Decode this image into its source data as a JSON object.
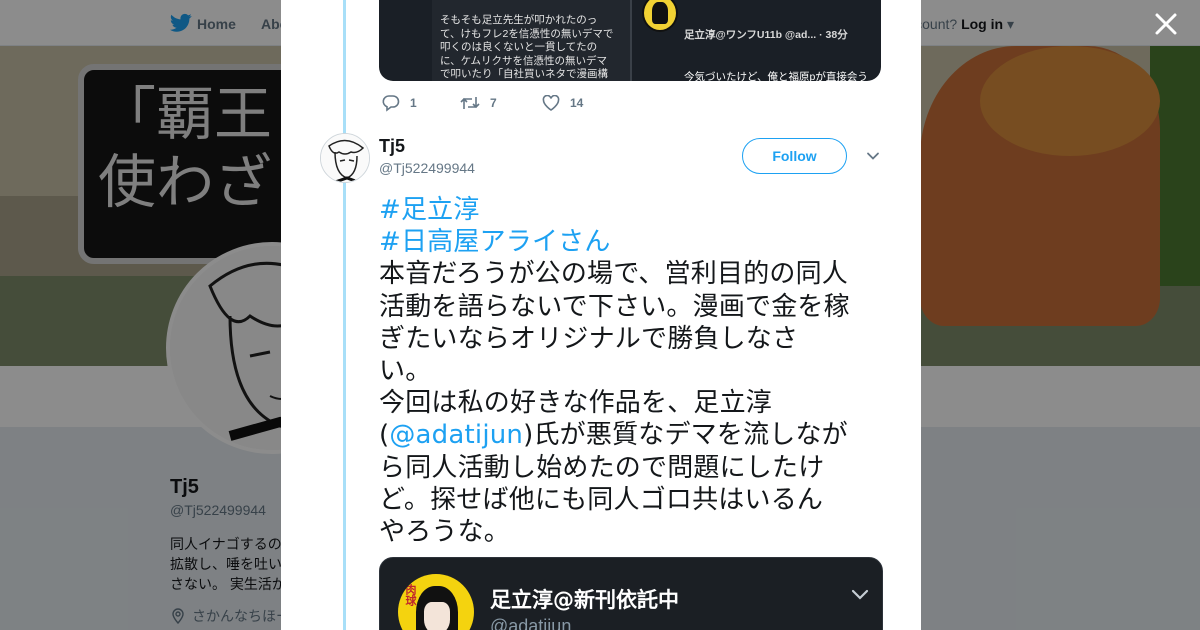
{
  "nav": {
    "home_label": "Home",
    "about_label": "Abo",
    "account_prompt": "ccount?",
    "login_label": "Log in"
  },
  "banner": {
    "sign_text": "「覇王\n使わざ"
  },
  "profile": {
    "name": "Tj5",
    "handle": "@Tj522499944",
    "bio": "同人イナゴするの\n拡散し、唾を吐い\nさない。 実生活が",
    "location": "さかんなちほー"
  },
  "previous_tweet": {
    "media_left_text": "そもそも足立先生が叩かれたのっ\nて、けもフレ2を信憑性の無いデマで\n叩くのは良くないと一貫してたの\nに、ケムリクサを信憑性の無いデマ\nで叩いたり「自社買いネタで漫画構",
    "media_right_header": "足立淳@ワンフU11b @ad... · 38分",
    "media_right_text": "今気づいたけど、俺と福原pが直接会う\nのが、一番良いんじゃないか？ 俺がや\nりたかったのは、例の疑惑の漫画化なん\nだから。疑惑だろうがデマだろうが真実\nだろうが、漫画にできるなら土下座でも",
    "reply_count": "1",
    "retweet_count": "7",
    "like_count": "14"
  },
  "tweet": {
    "name": "Tj5",
    "handle": "@Tj522499944",
    "follow_label": "Follow",
    "hashtag1": "#足立淳",
    "hashtag2": "#日高屋アライさん",
    "line1": "本音だろうが公の場で、営利目的の同人",
    "line2": "活動を語らないで下さい。漫画で金を稼",
    "line3": "ぎたいならオリジナルで勝負しなさ",
    "line4": "い。",
    "line5": "今回は私の好きな作品を、足立淳",
    "line6_open": "(",
    "mention": "@adatijun",
    "line6_rest": ")氏が悪質なデマを流しなが",
    "line7": "ら同人活動し始めたので問題にしたけ",
    "line8": "ど。探せば他にも同人ゴロ共はいるん",
    "line9": "やろうな。"
  },
  "quoted_card": {
    "avatar_tag": "肉球",
    "name": "足立淳@新刊依託中",
    "handle": "@adatijun"
  },
  "colors": {
    "accent": "#1da1f2",
    "thread_line": "#a8dff8",
    "muted": "#657786"
  }
}
